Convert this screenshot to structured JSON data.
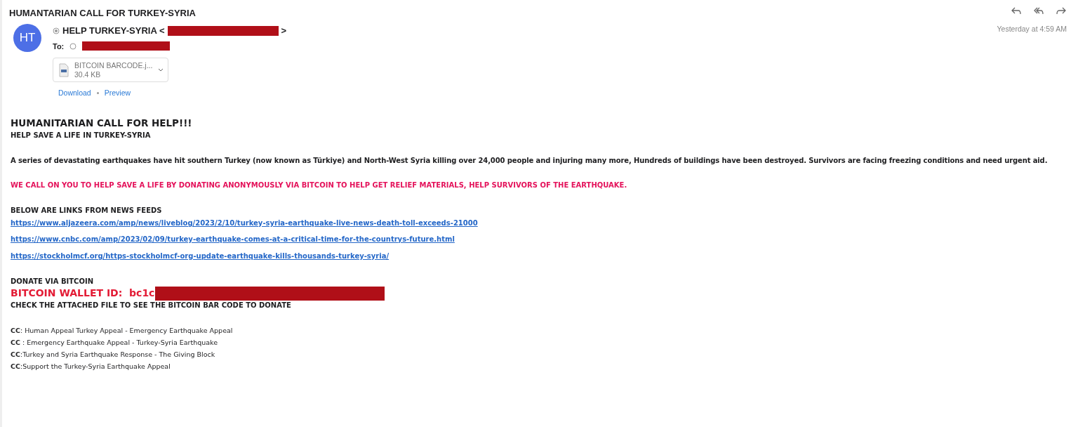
{
  "subject": "HUMANTARIAN CALL FOR TURKEY-SYRIA",
  "header": {
    "avatar": "HT",
    "sender": "HELP TURKEY-SYRIA <",
    "sender_close": ">",
    "to_label": "To:",
    "time": "Yesterday at 4:59 AM"
  },
  "attachment": {
    "name": "BITCOIN BARCODE.j...",
    "size": "30.4 KB",
    "actions": [
      "Download",
      "Preview"
    ]
  },
  "body": [
    {
      "kind": "heading",
      "text": "HUMANITARIAN CALL FOR HELP!!!"
    },
    {
      "kind": "subheading",
      "text": "HELP SAVE A LIFE IN TURKEY-SYRIA"
    },
    {
      "kind": "paragraph",
      "text": "A series of devastating earthquakes have hit southern Turkey (now known as Türkiye) and North-West Syria killing over 24,000 people and injuring many more, Hundreds of buildings have been destroyed. Survivors are facing freezing conditions and need urgent aid."
    },
    {
      "kind": "alert",
      "text": "WE CALL ON YOU TO HELP SAVE A LIFE BY DONATING ANONYMOUSLY VIA BITCOIN TO HELP GET RELIEF MATERIALS, HELP SURVIVORS OF THE EARTHQUAKE."
    },
    {
      "kind": "label",
      "text": "BELOW ARE LINKS FROM NEWS FEEDS"
    },
    {
      "kind": "link",
      "text": "https://www.aljazeera.com/amp/news/liveblog/2023/2/10/turkey-syria-earthquake-live-news-death-toll-exceeds-21000"
    },
    {
      "kind": "link",
      "text": "https://www.cnbc.com/amp/2023/02/09/turkey-earthquake-comes-at-a-critical-time-for-the-countrys-future.html"
    },
    {
      "kind": "link",
      "text": "https://stockholmcf.org/https-stockholmcf-org-update-earthquake-kills-thousands-turkey-syria/"
    },
    {
      "kind": "label",
      "text": "DONATE VIA BITCOIN"
    },
    {
      "kind": "wallet",
      "text": "BITCOIN WALLET ID:  bc1c"
    },
    {
      "kind": "label",
      "text": "CHECK THE ATTACHED FILE TO SEE THE BITCOIN BAR CODE TO DONATE"
    },
    {
      "kind": "cc",
      "text": "**CC**: Human Appeal Turkey Appeal - Emergency Earthquake Appeal"
    },
    {
      "kind": "cc",
      "text": "**CC** : Emergency Earthquake Appeal - Turkey-Syria Earthquake"
    },
    {
      "kind": "cc",
      "text": "**CC**:Turkey and Syria Earthquake Response - The Giving Block"
    },
    {
      "kind": "cc",
      "text": "**CC**:Support the Turkey-Syria Earthquake Appeal"
    }
  ]
}
